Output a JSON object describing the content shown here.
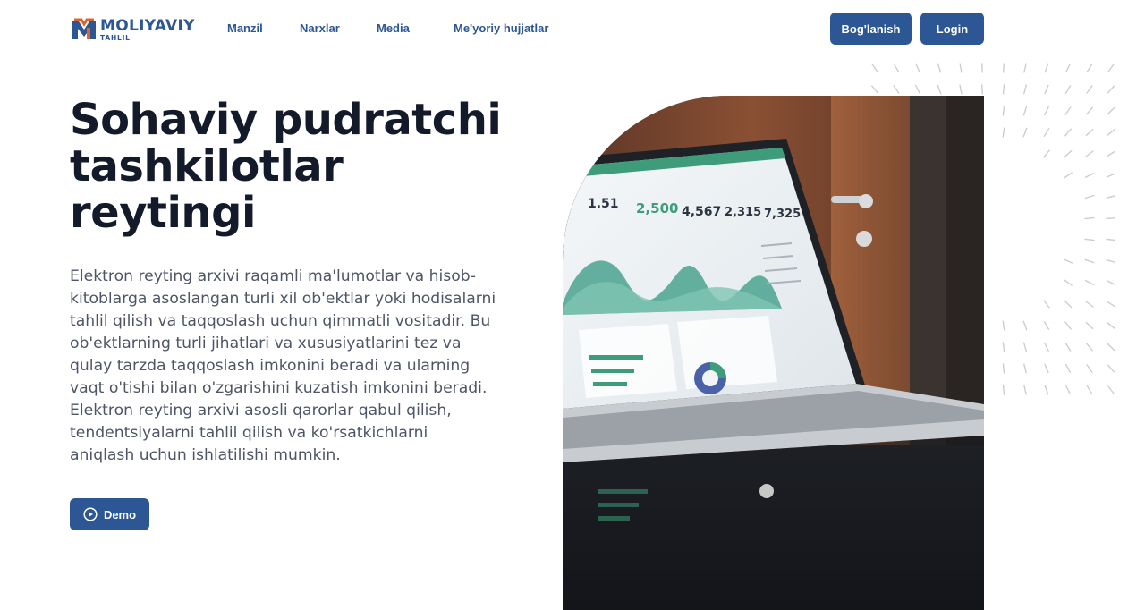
{
  "brand": {
    "name": "MOLIYAVIY",
    "subtitle": "TAHLIL",
    "color": "#2c5694"
  },
  "nav": {
    "items": [
      {
        "label": "Manzil"
      },
      {
        "label": "Narxlar"
      },
      {
        "label": "Media"
      },
      {
        "label": "Me'yoriy hujjatlar"
      }
    ]
  },
  "header_actions": {
    "contact_label": "Bog'lanish",
    "login_label": "Login"
  },
  "hero": {
    "title": "Sohaviy pudratchi tashkilotlar reytingi",
    "description": "Elektron reyting arxivi raqamli ma'lumotlar va hisob-kitoblarga asoslangan turli xil ob'ektlar yoki hodisalarni tahlil qilish va taqqoslash uchun qimmatli vositadir. Bu ob'ektlarning turli jihatlari va xususiyatlarini tez va qulay tarzda taqqoslash imkonini beradi va ularning vaqt o'tishi bilan o'zgarishini kuzatish imkonini beradi. Elektron reyting arxivi asosli qarorlar qabul qilish, tendentsiyalarni tahlil qilish va ko'rsatkichlarni aniqlash uchun ishlatilishi mumkin.",
    "demo_label": "Demo",
    "image_icon": "laptop-dashboard-photo"
  },
  "laptop_screen": {
    "metrics": [
      "1.51",
      "2,500",
      "4,567",
      "2,315",
      "7,325"
    ]
  },
  "colors": {
    "accent": "#2c5694",
    "title": "#131a2a",
    "body_text": "#4d5566",
    "chart_teal": "#4aa38f"
  }
}
